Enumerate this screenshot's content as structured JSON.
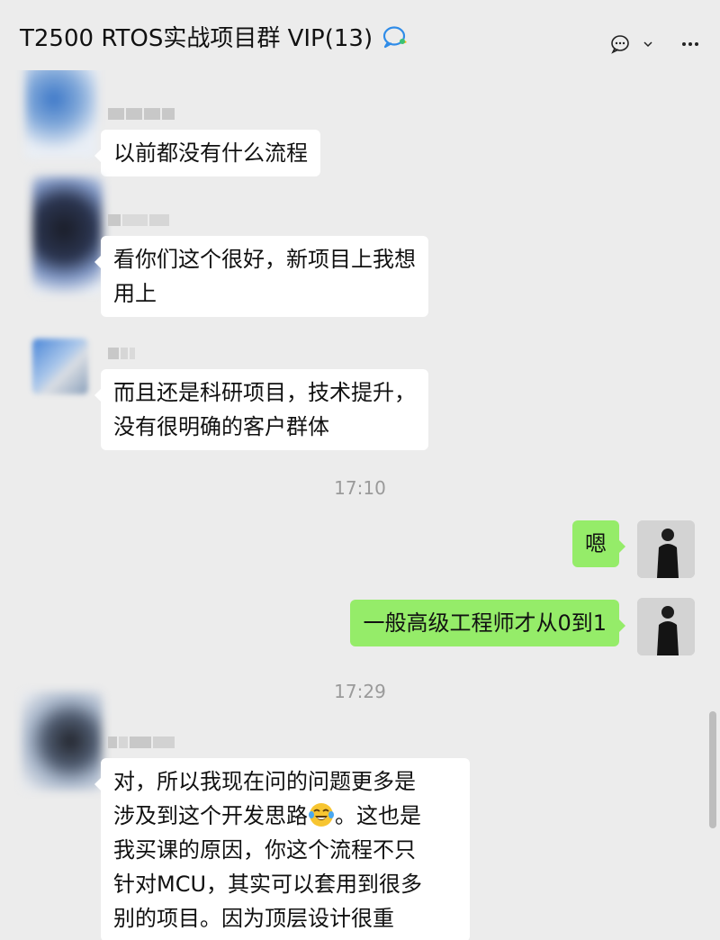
{
  "window": {
    "controls": [
      "pin-icon",
      "minimize-icon",
      "maximize-icon",
      "close-icon"
    ]
  },
  "header": {
    "title": "T2500 RTOS实战项目群 VIP(13)",
    "title_icon": "group-chat-icon",
    "actions": [
      "chat-bubble-icon",
      "chevron-down-icon",
      "more-icon"
    ]
  },
  "colors": {
    "background": "#ececec",
    "bubble_received": "#ffffff",
    "bubble_sent": "#95ec69",
    "timestamp": "#9a9a9a"
  },
  "messages": [
    {
      "sender": "other",
      "avatar": "blurred-avatar",
      "lines": [
        "以前都没有什么流程"
      ]
    },
    {
      "sender": "other",
      "avatar": "blurred-avatar",
      "lines": [
        "看你们这个很好，新项目上我想",
        "用上"
      ]
    },
    {
      "sender": "other",
      "avatar": "blurred-avatar",
      "lines": [
        "而且还是科研项目，技术提升，",
        "没有很明确的客户群体"
      ]
    },
    {
      "type": "timestamp",
      "text": "17:10"
    },
    {
      "sender": "self",
      "avatar": "user-avatar",
      "lines": [
        "嗯"
      ]
    },
    {
      "sender": "self",
      "avatar": "user-avatar",
      "lines": [
        "一般高级工程师才从0到1"
      ]
    },
    {
      "type": "timestamp",
      "text": "17:29"
    },
    {
      "sender": "other",
      "avatar": "blurred-avatar",
      "lines": [
        "对，所以我现在问的问题更多是",
        "涉及到这个开发思路",
        "。这也是",
        "我买课的原因，你这个流程不只",
        "针对MCU，其实可以套用到很多",
        "别的项目。因为顶层设计很重"
      ],
      "emoji": "laughing-tears-emoji"
    }
  ]
}
